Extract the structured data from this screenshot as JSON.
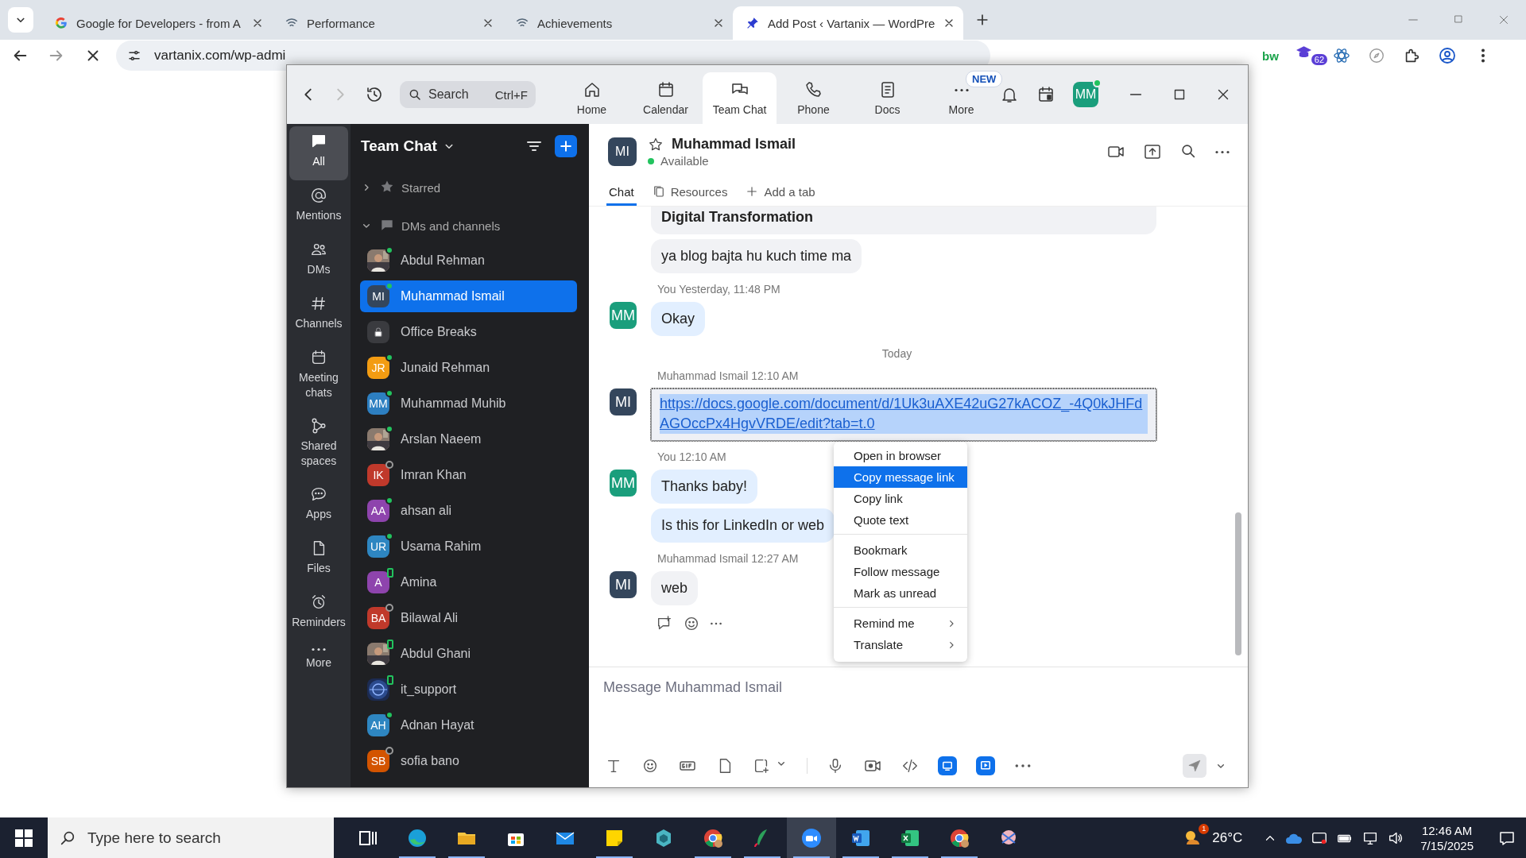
{
  "browser": {
    "tabs": [
      {
        "title": "Google for Developers - from A",
        "kind": "google",
        "selected": false
      },
      {
        "title": "Performance",
        "kind": "wave",
        "selected": false
      },
      {
        "title": "Achievements",
        "kind": "wave",
        "selected": false
      },
      {
        "title": "Add Post ‹ Vartanix — WordPre",
        "kind": "wordpress",
        "selected": true
      }
    ],
    "address": "vartanix.com/wp-admi",
    "extension_label": "bw",
    "extension_badge": "62"
  },
  "zoom": {
    "nav": {
      "search": {
        "placeholder": "Search",
        "shortcut": "Ctrl+F"
      },
      "tabs": [
        {
          "label": "Home",
          "kind": "home",
          "selected": false
        },
        {
          "label": "Calendar",
          "kind": "calendar",
          "selected": false
        },
        {
          "label": "Team Chat",
          "kind": "chat",
          "selected": true
        },
        {
          "label": "Phone",
          "kind": "phone",
          "selected": false
        },
        {
          "label": "Docs",
          "kind": "docs",
          "selected": false
        },
        {
          "label": "More",
          "kind": "more",
          "selected": false,
          "badge": "NEW"
        }
      ],
      "avatar": "MM"
    },
    "rail": [
      {
        "label": "All",
        "kind": "all",
        "selected": true
      },
      {
        "label": "Mentions",
        "kind": "mentions",
        "selected": false
      },
      {
        "label": "DMs",
        "kind": "dms",
        "selected": false
      },
      {
        "label": "Channels",
        "kind": "channels",
        "selected": false
      },
      {
        "label": "Meeting chats",
        "kind": "meeting",
        "selected": false
      },
      {
        "label": "Shared spaces",
        "kind": "shared",
        "selected": false
      },
      {
        "label": "Apps",
        "kind": "apps",
        "selected": false
      },
      {
        "label": "Files",
        "kind": "files",
        "selected": false
      },
      {
        "label": "Reminders",
        "kind": "reminders",
        "selected": false
      },
      {
        "label": "More",
        "kind": "more",
        "selected": false
      }
    ],
    "sidebar": {
      "title": "Team Chat",
      "sections": [
        {
          "label": "Starred",
          "kind": "starred",
          "expanded": false
        },
        {
          "label": "DMs and channels",
          "kind": "dms",
          "expanded": true,
          "children": [
            {
              "name": "Abdul Rehman",
              "online": true,
              "selected": false
            },
            {
              "name": "Muhammad Ismail",
              "kind": "initials",
              "initials": "MI",
              "color": "#34465c",
              "online": true,
              "selected": true
            },
            {
              "name": "Office Breaks",
              "kind": "lock",
              "selected": false
            },
            {
              "name": "Junaid Rehman",
              "kind": "initials",
              "initials": "JR",
              "color": "#f39c12",
              "online": true,
              "selected": false
            },
            {
              "name": "Muhammad Muhib",
              "kind": "initials",
              "initials": "MM",
              "color": "#2d7fc1",
              "online": true,
              "selected": false
            },
            {
              "name": "Arslan Naeem",
              "online": true,
              "selected": false
            },
            {
              "name": "Imran Khan",
              "kind": "initials",
              "initials": "IK",
              "color": "#c0392b",
              "online": false,
              "selected": false
            },
            {
              "name": "ahsan ali",
              "kind": "initials",
              "initials": "AA",
              "color": "#8e44ad",
              "online": true,
              "selected": false
            },
            {
              "name": "Usama Rahim",
              "kind": "initials",
              "initials": "UR",
              "color": "#2e86c1",
              "online": true,
              "selected": false
            },
            {
              "name": "Amina",
              "kind": "initials",
              "initials": "A",
              "color": "#8e44ad",
              "online": true,
              "mobile": true,
              "selected": false
            },
            {
              "name": "Bilawal Ali",
              "kind": "initials",
              "initials": "BA",
              "color": "#c0392b",
              "online": false,
              "selected": false
            },
            {
              "name": "Abdul Ghani",
              "online": true,
              "mobile": true,
              "selected": false
            },
            {
              "name": "it_support",
              "kind": "logo",
              "online": true,
              "mobile": true,
              "selected": false
            },
            {
              "name": "Adnan Hayat",
              "kind": "initials",
              "initials": "AH",
              "color": "#2e86c1",
              "online": true,
              "selected": false
            },
            {
              "name": "sofia bano",
              "kind": "initials",
              "initials": "SB",
              "color": "#d35400",
              "online": false,
              "selected": false
            }
          ]
        }
      ]
    },
    "chat": {
      "header": {
        "initials": "MI",
        "name": "Muhammad Ismail",
        "status": "Available"
      },
      "tabs": [
        {
          "label": "Chat",
          "kind": "chat",
          "selected": true
        },
        {
          "label": "Resources",
          "kind": "resources",
          "selected": false
        },
        {
          "label": "Add a tab",
          "kind": "add",
          "selected": false
        }
      ],
      "messages": [
        {
          "kind": "group",
          "mine": false,
          "bubbles": [
            {
              "kind": "heading",
              "text": "Digital Transformation",
              "selected": false
            },
            {
              "kind": "text",
              "text": "ya blog bajta hu kuch time ma",
              "selected": false
            }
          ]
        },
        {
          "kind": "group",
          "mine": true,
          "sender": "You",
          "time": "Yesterday, 11:48 PM",
          "initials": "MM",
          "color": "#1a9e7c",
          "bubbles": [
            {
              "kind": "text",
              "text": "Okay",
              "selected": false
            }
          ]
        },
        {
          "kind": "divider",
          "text": "Today"
        },
        {
          "kind": "group",
          "mine": false,
          "sender": "Muhammad Ismail",
          "time": "12:10 AM",
          "initials": "MI",
          "color": "#34465c",
          "bubbles": [
            {
              "kind": "link",
              "text": "https://docs.google.com/document/d/1Uk3uAXE42uG27kACOZ_-4Q0kJHFdAGOccPx4HgvVRDE/edit?tab=t.0",
              "selected": true
            }
          ]
        },
        {
          "kind": "group",
          "mine": true,
          "sender": "You",
          "time": "12:10 AM",
          "initials": "MM",
          "color": "#1a9e7c",
          "bubbles": [
            {
              "kind": "text",
              "text": "Thanks baby!",
              "selected": false
            },
            {
              "kind": "text",
              "text": "Is this for LinkedIn or web",
              "selected": false
            }
          ]
        },
        {
          "kind": "group",
          "mine": false,
          "sender": "Muhammad Ismail",
          "time": "12:27 AM",
          "initials": "MI",
          "color": "#34465c",
          "bubbles": [
            {
              "kind": "text",
              "text": "web",
              "selected": false
            }
          ],
          "actions": true
        }
      ],
      "composer": {
        "placeholder": "Message Muhammad Ismail"
      }
    },
    "context_menu": {
      "groups": [
        [
          {
            "label": "Open in browser",
            "selected": false,
            "submenu": false
          },
          {
            "label": "Copy message link",
            "selected": true,
            "submenu": false
          },
          {
            "label": "Copy link",
            "selected": false,
            "submenu": false
          },
          {
            "label": "Quote text",
            "selected": false,
            "submenu": false
          }
        ],
        [
          {
            "label": "Bookmark",
            "selected": false,
            "submenu": false
          },
          {
            "label": "Follow message",
            "selected": false,
            "submenu": false
          },
          {
            "label": "Mark as unread",
            "selected": false,
            "submenu": false
          }
        ],
        [
          {
            "label": "Remind me",
            "selected": false,
            "submenu": true
          },
          {
            "label": "Translate",
            "selected": false,
            "submenu": true
          }
        ]
      ]
    }
  },
  "taskbar": {
    "search_placeholder": "Type here to search",
    "apps": [
      {
        "kind": "taskview",
        "selected": false,
        "running": false
      },
      {
        "kind": "edge",
        "selected": false,
        "running": true
      },
      {
        "kind": "explorer",
        "selected": false,
        "running": true
      },
      {
        "kind": "store",
        "selected": false,
        "running": false
      },
      {
        "kind": "mail",
        "selected": false,
        "running": false
      },
      {
        "kind": "notes",
        "selected": false,
        "running": true
      },
      {
        "kind": "hexagon",
        "selected": false,
        "running": false
      },
      {
        "kind": "chrome",
        "selected": false,
        "running": true
      },
      {
        "kind": "feather",
        "selected": false,
        "running": true
      },
      {
        "kind": "zoom",
        "selected": true,
        "running": true
      },
      {
        "kind": "word",
        "selected": false,
        "running": true
      },
      {
        "kind": "excel",
        "selected": false,
        "running": true
      },
      {
        "kind": "chrome",
        "selected": false,
        "running": true
      },
      {
        "kind": "snip",
        "selected": false,
        "running": false
      }
    ],
    "weather": "26°C",
    "weather_badge": "1",
    "time": "12:46 AM",
    "date": "7/15/2025"
  }
}
